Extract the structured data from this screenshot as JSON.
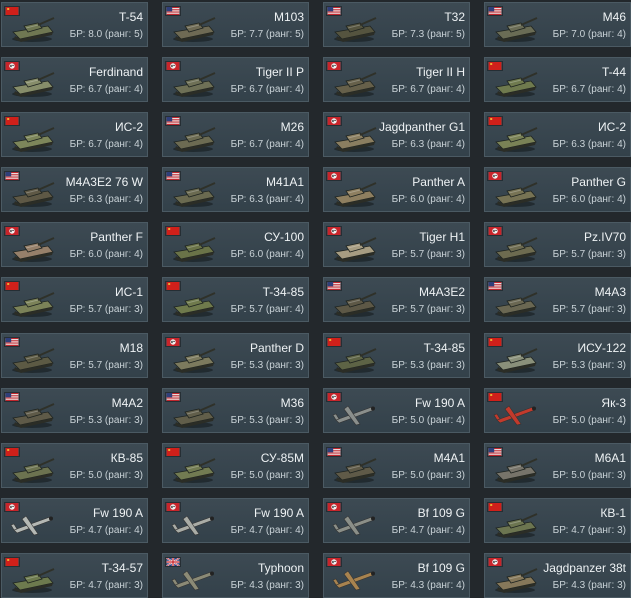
{
  "vehicles": [
    {
      "name": "T-54",
      "br": "БР: 8.0 (ранг: 5)",
      "nation": "ussr",
      "kind": "tank",
      "color": "#6f7752"
    },
    {
      "name": "M103",
      "br": "БР: 7.7 (ранг: 5)",
      "nation": "usa",
      "kind": "tank",
      "color": "#6e6a54"
    },
    {
      "name": "T32",
      "br": "БР: 7.3 (ранг: 5)",
      "nation": "usa",
      "kind": "tank",
      "color": "#55543f"
    },
    {
      "name": "M46",
      "br": "БР: 7.0 (ранг: 4)",
      "nation": "usa",
      "kind": "tank",
      "color": "#6a6c55"
    },
    {
      "name": "Ferdinand",
      "br": "БР: 6.7 (ранг: 4)",
      "nation": "germany",
      "kind": "tank",
      "color": "#868d6a"
    },
    {
      "name": "Tiger II P",
      "br": "БР: 6.7 (ранг: 4)",
      "nation": "germany",
      "kind": "tank",
      "color": "#6e7056"
    },
    {
      "name": "Tiger II H",
      "br": "БР: 6.7 (ранг: 4)",
      "nation": "germany",
      "kind": "tank",
      "color": "#66604a"
    },
    {
      "name": "T-44",
      "br": "БР: 6.7 (ранг: 4)",
      "nation": "ussr",
      "kind": "tank",
      "color": "#6f7a4e"
    },
    {
      "name": "ИС-2",
      "br": "БР: 6.7 (ранг: 4)",
      "nation": "ussr",
      "kind": "tank",
      "color": "#7d865a"
    },
    {
      "name": "M26",
      "br": "БР: 6.7 (ранг: 4)",
      "nation": "usa",
      "kind": "tank",
      "color": "#6c6b52"
    },
    {
      "name": "Jagdpanther G1",
      "br": "БР: 6.3 (ранг: 4)",
      "nation": "germany",
      "kind": "tank",
      "color": "#8a7e60"
    },
    {
      "name": "ИС-2",
      "br": "БР: 6.3 (ранг: 4)",
      "nation": "ussr",
      "kind": "tank",
      "color": "#7a8256"
    },
    {
      "name": "M4A3E2 76 W",
      "br": "БР: 6.3 (ранг: 4)",
      "nation": "usa",
      "kind": "tank",
      "color": "#5e5845"
    },
    {
      "name": "M41A1",
      "br": "БР: 6.3 (ранг: 4)",
      "nation": "usa",
      "kind": "tank",
      "color": "#6a6a50"
    },
    {
      "name": "Panther A",
      "br": "БР: 6.0 (ранг: 4)",
      "nation": "germany",
      "kind": "tank",
      "color": "#8e7f60"
    },
    {
      "name": "Panther G",
      "br": "БР: 6.0 (ранг: 4)",
      "nation": "germany",
      "kind": "tank",
      "color": "#777354"
    },
    {
      "name": "Panther F",
      "br": "БР: 6.0 (ранг: 4)",
      "nation": "germany",
      "kind": "tank",
      "color": "#96806a"
    },
    {
      "name": "СУ-100",
      "br": "БР: 6.0 (ранг: 4)",
      "nation": "ussr",
      "kind": "tank",
      "color": "#6a7348"
    },
    {
      "name": "Tiger H1",
      "br": "БР: 5.7 (ранг: 3)",
      "nation": "germany",
      "kind": "tank",
      "color": "#a79d82"
    },
    {
      "name": "Pz.IV70",
      "br": "БР: 5.7 (ранг: 3)",
      "nation": "germany",
      "kind": "tank",
      "color": "#6d6b50"
    },
    {
      "name": "ИС-1",
      "br": "БР: 5.7 (ранг: 3)",
      "nation": "ussr",
      "kind": "tank",
      "color": "#7b8258"
    },
    {
      "name": "T-34-85",
      "br": "БР: 5.7 (ранг: 4)",
      "nation": "ussr",
      "kind": "tank",
      "color": "#6f7a4c"
    },
    {
      "name": "M4A3E2",
      "br": "БР: 5.7 (ранг: 3)",
      "nation": "usa",
      "kind": "tank",
      "color": "#5d5846"
    },
    {
      "name": "M4A3",
      "br": "БР: 5.7 (ранг: 3)",
      "nation": "usa",
      "kind": "tank",
      "color": "#6a6752"
    },
    {
      "name": "M18",
      "br": "БР: 5.7 (ранг: 3)",
      "nation": "usa",
      "kind": "tank",
      "color": "#5c5a44"
    },
    {
      "name": "Panther D",
      "br": "БР: 5.3 (ранг: 3)",
      "nation": "germany",
      "kind": "tank",
      "color": "#7c7a5e"
    },
    {
      "name": "T-34-85",
      "br": "БР: 5.3 (ранг: 3)",
      "nation": "ussr",
      "kind": "tank",
      "color": "#5d6345"
    },
    {
      "name": "ИСУ-122",
      "br": "БР: 5.3 (ранг: 3)",
      "nation": "ussr",
      "kind": "tank",
      "color": "#8a907a"
    },
    {
      "name": "M4A2",
      "br": "БР: 5.3 (ранг: 3)",
      "nation": "usa",
      "kind": "tank",
      "color": "#5e5a48"
    },
    {
      "name": "M36",
      "br": "БР: 5.3 (ранг: 3)",
      "nation": "usa",
      "kind": "tank",
      "color": "#615e4a"
    },
    {
      "name": "Fw 190 A",
      "br": "БР: 5.0 (ранг: 4)",
      "nation": "germany",
      "kind": "plane",
      "color": "#8a8f8c"
    },
    {
      "name": "Як-3",
      "br": "БР: 5.0 (ранг: 4)",
      "nation": "ussr",
      "kind": "plane",
      "color": "#c23a2c"
    },
    {
      "name": "КВ-85",
      "br": "БР: 5.0 (ранг: 3)",
      "nation": "ussr",
      "kind": "tank",
      "color": "#6c7350"
    },
    {
      "name": "СУ-85М",
      "br": "БР: 5.0 (ранг: 3)",
      "nation": "ussr",
      "kind": "tank",
      "color": "#727b52"
    },
    {
      "name": "M4A1",
      "br": "БР: 5.0 (ранг: 3)",
      "nation": "usa",
      "kind": "tank",
      "color": "#5f5a48"
    },
    {
      "name": "M6A1",
      "br": "БР: 5.0 (ранг: 3)",
      "nation": "usa",
      "kind": "tank",
      "color": "#77746a"
    },
    {
      "name": "Fw 190 A",
      "br": "БР: 4.7 (ранг: 4)",
      "nation": "germany",
      "kind": "plane",
      "color": "#b4b8b4"
    },
    {
      "name": "Fw 190 A",
      "br": "БР: 4.7 (ранг: 4)",
      "nation": "germany",
      "kind": "plane",
      "color": "#a9aca6"
    },
    {
      "name": "Bf 109 G",
      "br": "БР: 4.7 (ранг: 4)",
      "nation": "germany",
      "kind": "plane",
      "color": "#8b8f88"
    },
    {
      "name": "КВ-1",
      "br": "БР: 4.7 (ранг: 3)",
      "nation": "ussr",
      "kind": "tank",
      "color": "#6c7550"
    },
    {
      "name": "T-34-57",
      "br": "БР: 4.7 (ранг: 3)",
      "nation": "ussr",
      "kind": "tank",
      "color": "#6d7a4e"
    },
    {
      "name": "Typhoon",
      "br": "БР: 4.3 (ранг: 3)",
      "nation": "uk",
      "kind": "plane",
      "color": "#8b8a76"
    },
    {
      "name": "Bf 109 G",
      "br": "БР: 4.3 (ранг: 4)",
      "nation": "germany",
      "kind": "plane",
      "color": "#a8834f"
    },
    {
      "name": "Jagdpanzer 38t",
      "br": "БР: 4.3 (ранг: 3)",
      "nation": "germany",
      "kind": "tank",
      "color": "#86785a"
    }
  ]
}
